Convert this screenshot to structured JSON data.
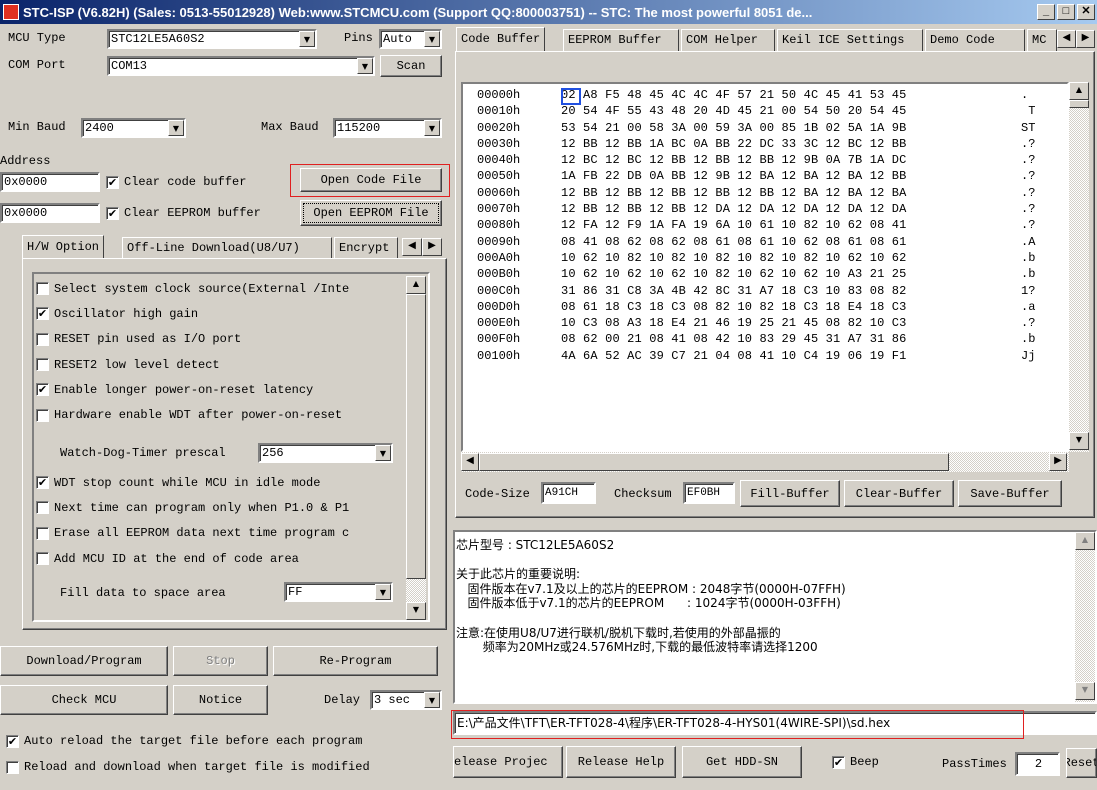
{
  "window": {
    "title": "STC-ISP (V6.82H) (Sales: 0513-55012928) Web:www.STCMCU.com  (Support QQ:800003751) -- STC: The most powerful 8051 de...",
    "min_label": "_",
    "max_label": "□",
    "close_label": "✕"
  },
  "left": {
    "mcu_type_label": "MCU Type",
    "mcu_type_value": "STC12LE5A60S2",
    "pins_label": "Pins",
    "pins_value": "Auto",
    "com_port_label": "COM Port",
    "com_port_value": "COM13",
    "scan_label": "Scan",
    "min_baud_label": "Min Baud",
    "min_baud_value": "2400",
    "max_baud_label": "Max Baud",
    "max_baud_value": "115200",
    "address_label": "Address",
    "addr1_value": "0x0000",
    "clear_code_label": "Clear code buffer",
    "open_code_label": "Open Code File",
    "addr2_value": "0x0000",
    "clear_eeprom_label": "Clear EEPROM buffer",
    "open_eeprom_label": "Open EEPROM File",
    "tabs": [
      "H/W Option",
      "Off-Line Download(U8/U7)",
      "Encrypt"
    ],
    "options": [
      {
        "label": "Select system clock source(External /Inte",
        "checked": false
      },
      {
        "label": "Oscillator high gain",
        "checked": true
      },
      {
        "label": "RESET pin used as I/O port",
        "checked": false
      },
      {
        "label": "RESET2 low level detect",
        "checked": false
      },
      {
        "label": "Enable longer power-on-reset latency",
        "checked": true
      },
      {
        "label": "Hardware enable WDT after power-on-reset",
        "checked": false
      }
    ],
    "wdt_prescale_label": "Watch-Dog-Timer prescal",
    "wdt_prescale_value": "256",
    "options2": [
      {
        "label": "WDT stop count while MCU in idle mode",
        "checked": true
      },
      {
        "label": "Next time can program only when P1.0 & P1",
        "checked": false
      },
      {
        "label": "Erase all EEPROM data next time program c",
        "checked": false
      },
      {
        "label": "Add MCU ID at the end of code area",
        "checked": false
      }
    ],
    "fill_label": "Fill data to space area",
    "fill_value": "FF",
    "download_label": "Download/Program",
    "stop_label": "Stop",
    "reprogram_label": "Re-Program",
    "check_mcu_label": "Check MCU",
    "notice_label": "Notice",
    "delay_label": "Delay",
    "delay_value": "3 sec",
    "auto_reload_label": "Auto reload the target file before each program",
    "auto_reload_checked": true,
    "reload_download_label": "Reload and download when target file is modified",
    "reload_download_checked": false
  },
  "right": {
    "tabs": [
      "Code Buffer",
      "EEPROM Buffer",
      "COM Helper",
      "Keil ICE Settings",
      "Demo Code",
      "MC"
    ],
    "hex_rows": [
      {
        "addr": "00000h",
        "bytes": "02 A8 F5 48 45 4C 4C 4F 57 21 50 4C 45 41 53 45",
        "ascii": "."
      },
      {
        "addr": "00010h",
        "bytes": "20 54 4F 55 43 48 20 4D 45 21 00 54 50 20 54 45",
        "ascii": " T"
      },
      {
        "addr": "00020h",
        "bytes": "53 54 21 00 58 3A 00 59 3A 00 85 1B 02 5A 1A 9B",
        "ascii": "ST"
      },
      {
        "addr": "00030h",
        "bytes": "12 BB 12 BB 1A BC 0A BB 22 DC 33 3C 12 BC 12 BB",
        "ascii": ".?"
      },
      {
        "addr": "00040h",
        "bytes": "12 BC 12 BC 12 BB 12 BB 12 BB 12 9B 0A 7B 1A DC",
        "ascii": ".?"
      },
      {
        "addr": "00050h",
        "bytes": "1A FB 22 DB 0A BB 12 9B 12 BA 12 BA 12 BA 12 BB",
        "ascii": ".?"
      },
      {
        "addr": "00060h",
        "bytes": "12 BB 12 BB 12 BB 12 BB 12 BB 12 BA 12 BA 12 BA",
        "ascii": ".?"
      },
      {
        "addr": "00070h",
        "bytes": "12 BB 12 BB 12 BB 12 DA 12 DA 12 DA 12 DA 12 DA",
        "ascii": ".?"
      },
      {
        "addr": "00080h",
        "bytes": "12 FA 12 F9 1A FA 19 6A 10 61 10 82 10 62 08 41",
        "ascii": ".?"
      },
      {
        "addr": "00090h",
        "bytes": "08 41 08 62 08 62 08 61 08 61 10 62 08 61 08 61",
        "ascii": ".A"
      },
      {
        "addr": "000A0h",
        "bytes": "10 62 10 82 10 82 10 82 10 82 10 82 10 62 10 62",
        "ascii": ".b"
      },
      {
        "addr": "000B0h",
        "bytes": "10 62 10 62 10 62 10 82 10 62 10 62 10 A3 21 25",
        "ascii": ".b"
      },
      {
        "addr": "000C0h",
        "bytes": "31 86 31 C8 3A 4B 42 8C 31 A7 18 C3 10 83 08 82",
        "ascii": "1?"
      },
      {
        "addr": "000D0h",
        "bytes": "08 61 18 C3 18 C3 08 82 10 82 18 C3 18 E4 18 C3",
        "ascii": ".a"
      },
      {
        "addr": "000E0h",
        "bytes": "10 C3 08 A3 18 E4 21 46 19 25 21 45 08 82 10 C3",
        "ascii": ".?"
      },
      {
        "addr": "000F0h",
        "bytes": "08 62 00 21 08 41 08 42 10 83 29 45 31 A7 31 86",
        "ascii": ".b"
      },
      {
        "addr": "00100h",
        "bytes": "4A 6A 52 AC 39 C7 21 04 08 41 10 C4 19 06 19 F1",
        "ascii": "Jj"
      }
    ],
    "code_size_label": "Code-Size",
    "code_size_value": "A91CH",
    "checksum_label": "Checksum",
    "checksum_value": "EF0BH",
    "fill_buffer_label": "Fill-Buffer",
    "clear_buffer_label": "Clear-Buffer",
    "save_buffer_label": "Save-Buffer",
    "info_lines": [
      "芯片型号 : STC12LE5A60S2",
      "",
      "关于此芯片的重要说明:",
      "   固件版本在v7.1及以上的芯片的EEPROM : 2048字节(0000H-07FFH)",
      "   固件版本低于v7.1的芯片的EEPROM      : 1024字节(0000H-03FFH)",
      "",
      "注意:在使用U8/U7进行联机/脱机下载时,若使用的外部晶振的",
      "       频率为20MHz或24.576MHz时,下载的最低波特率请选择1200"
    ],
    "file_path": "E:\\产品文件\\TFT\\ER-TFT028-4\\程序\\ER-TFT028-4-HYS01(4WIRE-SPI)\\sd.hex",
    "release_project_label": "elease Projec",
    "release_help_label": "Release Help",
    "get_hdd_label": "Get HDD-SN",
    "beep_label": "Beep",
    "beep_checked": true,
    "passtimes_label": "PassTimes",
    "passtimes_value": "2",
    "reset_label": "Reset"
  }
}
